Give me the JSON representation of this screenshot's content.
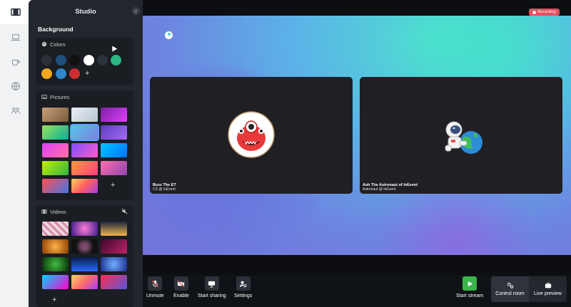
{
  "panel": {
    "title": "Studio",
    "section_title": "Background",
    "colors_label": "Colors",
    "pictures_label": "Pictures",
    "videos_label": "Videos",
    "color_swatches": [
      "#2b2f36",
      "#1f4f7a",
      "#111111",
      "#ffffff",
      "#2c333d",
      "#2bb583",
      "#f2a81c",
      "#2f86c8",
      "#cf2e2e"
    ]
  },
  "rail": {
    "items": [
      "film-icon",
      "laptop-icon",
      "coffee-icon",
      "globe-icon",
      "people-icon"
    ]
  },
  "stage": {
    "recording_label": "Recording",
    "participants": [
      {
        "name": "Buzz The ET",
        "subtitle": "CS @ InEvent"
      },
      {
        "name": "Ash The Astronaut of InEvent",
        "subtitle": "Astronaut @ InEvent"
      }
    ]
  },
  "controls": {
    "unmute": "Unmute",
    "enable": "Enable",
    "start_sharing": "Start sharing",
    "settings": "Settings",
    "start_stream": "Start stream",
    "control_room": "Control room",
    "live_preview": "Live preview"
  },
  "colors": {
    "accent_green": "#3ab54a",
    "recording_red": "#e4505f",
    "panel_bg": "#22262d"
  }
}
